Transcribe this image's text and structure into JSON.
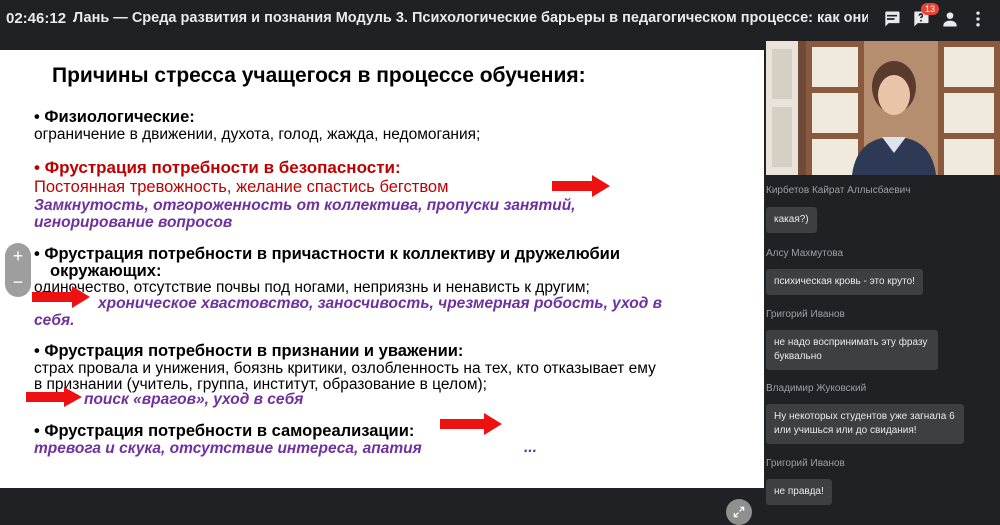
{
  "topbar": {
    "clock": "02:46:12",
    "title": "Лань — Среда развития и познания    Модуль 3. Психологические барьеры в педагогическом процессе: как они устроены ...",
    "notification_count": "13",
    "icons": [
      "chat-icon",
      "questions-icon",
      "user-icon",
      "more-icon"
    ]
  },
  "slide": {
    "heading": "Причины стресса учащегося в процессе обучения:",
    "physio_title": "• Физиологические:",
    "physio_text": "ограничение в движении, духота, голод, жажда, недомогания;",
    "safety_title": "• Фрустрация потребности в безопасности:",
    "safety_text": "Постоянная тревожность, желание спастись бегством",
    "safety_purple_1": "Замкнутость, отгороженность от коллектива, пропуски занятий,",
    "safety_purple_2": "игнорирование вопросов",
    "belong_title_1": "• Фрустрация потребности в причастности к коллективу и дружелюбии",
    "belong_title_2": "окружающих:",
    "belong_text": "одиночество, отсутствие почвы под ногами, неприязнь и ненависть к другим;",
    "belong_purple_1": "хроническое хвастовство,  заносчивость, чрезмерная робость, уход в",
    "belong_purple_2": "себя.",
    "recog_title": "• Фрустрация потребности в признании и уважении:",
    "recog_text_1": "страх провала и унижения, боязнь критики, озлобленность на тех, кто отказывает ему",
    "recog_text_2": "в признании (учитель, группа, институт, образование в целом);",
    "recog_purple": "поиск «врагов», уход в себя",
    "self_title": "• Фрустрация потребности в самореализации:",
    "self_purple": "тревога и скука, отсутствие интереса, апатия",
    "ellipsis": "..."
  },
  "controls": {
    "zoom_in": "+",
    "zoom_out": "−"
  },
  "chat": {
    "messages": [
      {
        "author": "Кирбетов Кайрат Аллысбаевич",
        "text": "какая?)"
      },
      {
        "author": "Алсу Махмутова",
        "text": "психическая кровь - это круто!"
      },
      {
        "author": "Григорий Иванов",
        "text_1": "не надо воспринимать эту фразу",
        "text_2": "буквально"
      },
      {
        "author": "Владимир Жуковский",
        "text_1": "Ну некоторых студентов уже загнала 6",
        "text_2": "или учишься или до свидания!"
      },
      {
        "author": "Григорий Иванов",
        "text": "не правда!"
      }
    ]
  },
  "colors": {
    "red": "#c00000",
    "purple": "#7030a0",
    "arrow": "#ee1111",
    "chat_bubble": "#3c4043"
  }
}
